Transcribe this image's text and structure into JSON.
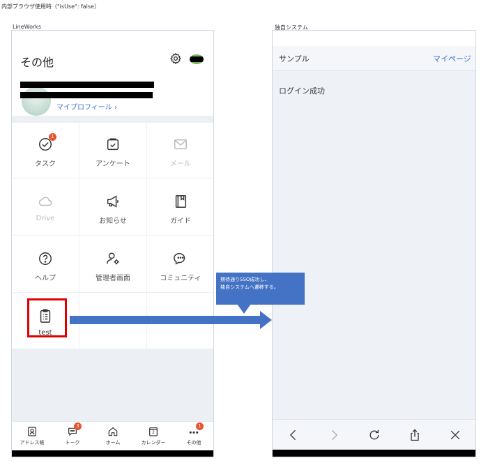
{
  "caption": "内部ブラウザ使用時（\"isUse\": false）",
  "left_label": "LineWorks",
  "right_label": "独自システム",
  "left_app": {
    "title": "その他",
    "profile_link": "マイプロフィール",
    "grid": [
      {
        "label": "タスク",
        "icon": "check-circle-icon",
        "badge": "1",
        "disabled": false
      },
      {
        "label": "アンケート",
        "icon": "survey-icon",
        "disabled": false
      },
      {
        "label": "メール",
        "icon": "mail-icon",
        "disabled": true
      },
      {
        "label": "Drive",
        "icon": "cloud-icon",
        "disabled": true
      },
      {
        "label": "お知らせ",
        "icon": "megaphone-icon",
        "disabled": false
      },
      {
        "label": "ガイド",
        "icon": "book-icon",
        "disabled": false
      },
      {
        "label": "ヘルプ",
        "icon": "help-icon",
        "disabled": false
      },
      {
        "label": "管理者画面",
        "icon": "admin-icon",
        "disabled": false
      },
      {
        "label": "コミュニティ",
        "icon": "chat-bubbles-icon",
        "disabled": false
      },
      {
        "label": "test",
        "icon": "clipboard-icon",
        "disabled": false
      }
    ],
    "tabs": [
      {
        "label": "アドレス帳",
        "icon": "address-book-icon"
      },
      {
        "label": "トーク",
        "icon": "talk-icon",
        "badge": "3"
      },
      {
        "label": "ホーム",
        "icon": "home-icon"
      },
      {
        "label": "カレンダー",
        "icon": "calendar-icon",
        "day": "2"
      },
      {
        "label": "その他",
        "icon": "more-icon",
        "badge": "1"
      }
    ]
  },
  "right_app": {
    "header_title": "サンプル",
    "header_link": "マイページ",
    "body_text": "ログイン成功",
    "toolbar": [
      "back-icon",
      "forward-icon",
      "reload-icon",
      "share-icon",
      "close-icon"
    ]
  },
  "annotation": {
    "line1": "期待通りSSO成功し、",
    "line2": "独自システムへ遷移する。"
  },
  "colors": {
    "accent": "#3b6bd6",
    "badge": "#e8542f",
    "callout": "#4472c4",
    "highlight": "#e00000"
  }
}
